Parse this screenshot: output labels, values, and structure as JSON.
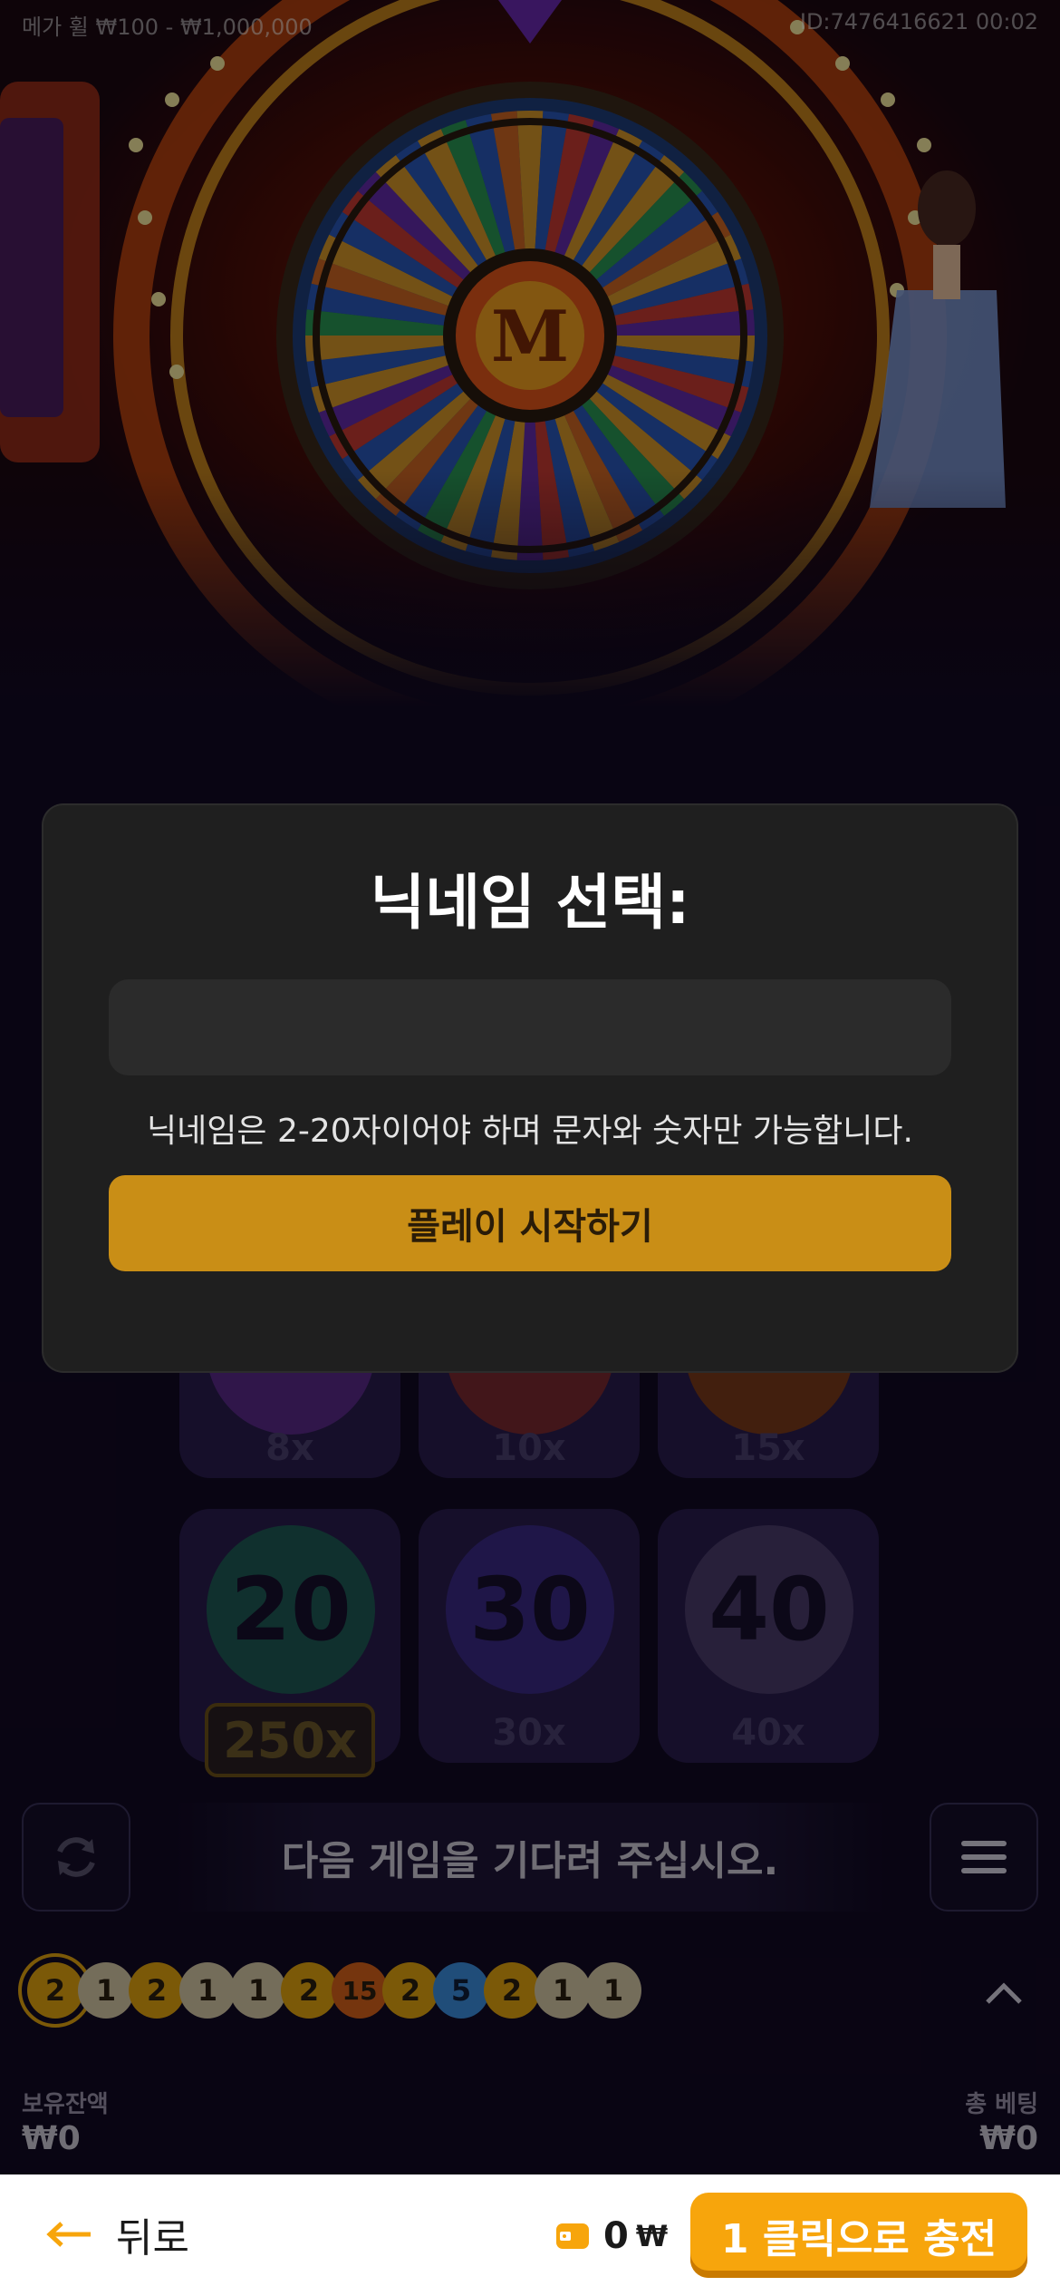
{
  "video": {
    "header_left": "메가 휠  ₩100 - ₩1,000,000",
    "header_right": "ID:7476416621  00:02",
    "wheel_center_letter": "M"
  },
  "board": {
    "top_row_multipliers": [
      "8x",
      "10x",
      "15x"
    ],
    "tiles": [
      {
        "number": "20",
        "multiplier": "250x",
        "color": "#1f5a55"
      },
      {
        "number": "30",
        "multiplier": "30x",
        "color": "#3a2a86"
      },
      {
        "number": "40",
        "multiplier": "40x",
        "color": "#4a3c6c"
      }
    ],
    "top_row_colors": [
      "#5a2a8a",
      "#7a2a30",
      "#7a3a1a"
    ]
  },
  "status": {
    "message": "다음 게임을 기다려 주십시오."
  },
  "history": {
    "results": [
      "2",
      "1",
      "2",
      "1",
      "1",
      "2",
      "15",
      "2",
      "5",
      "2",
      "1",
      "1"
    ]
  },
  "balance": {
    "label": "보유잔액",
    "value": "₩0",
    "bet_label": "총 베팅",
    "bet_value": "₩0"
  },
  "modal": {
    "title": "닉네임 선택:",
    "input_value": "",
    "input_placeholder": "",
    "hint": "닉네임은 2-20자이어야 하며 문자와 숫자만 가능합니다.",
    "start_button": "플레이 시작하기"
  },
  "bottom_bar": {
    "back_label": "뒤로",
    "wallet_amount": "0",
    "wallet_currency": "₩",
    "topup_button": "1 클릭으로 충전"
  },
  "colors": {
    "accent_gold": "#c98e16",
    "topup_orange": "#f7a50c",
    "back_arrow": "#f7a50c"
  }
}
